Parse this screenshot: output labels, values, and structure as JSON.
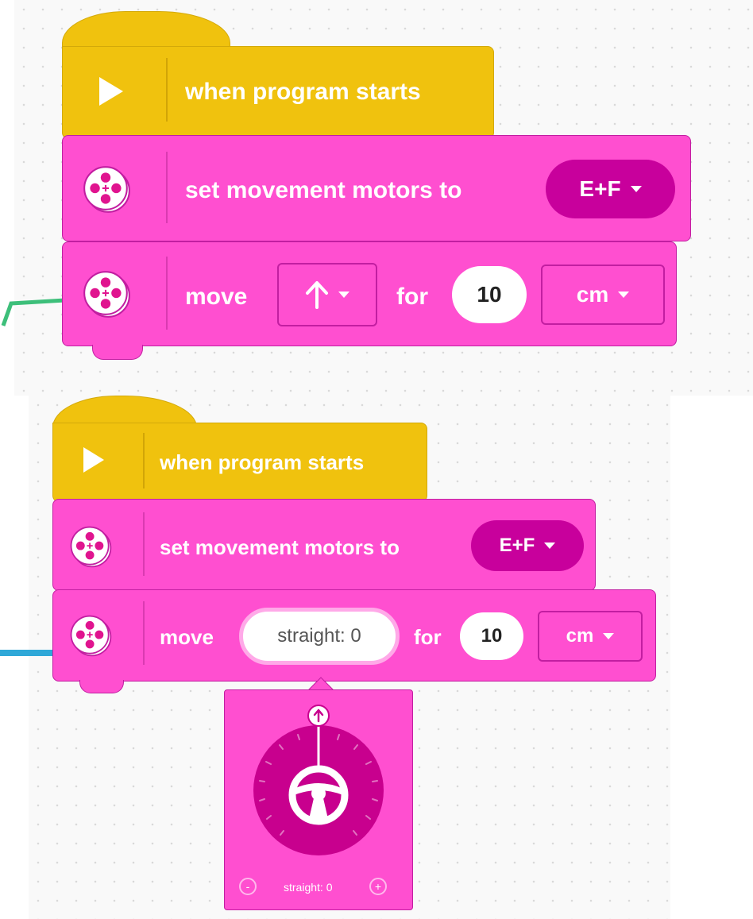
{
  "colors": {
    "hat": "#f0c20e",
    "motion": "#ff4fd0",
    "motion_dark": "#c8009c",
    "connector_green": "#3dbf7a",
    "connector_blue": "#2fa8d8"
  },
  "program_top": {
    "hat_label": "when program starts",
    "set_label": "set movement motors to",
    "set_value": "E+F",
    "move_label": "move",
    "direction_icon": "up-arrow-icon",
    "for_label": "for",
    "amount": "10",
    "unit": "cm"
  },
  "program_bottom": {
    "hat_label": "when program starts",
    "set_label": "set movement motors to",
    "set_value": "E+F",
    "move_label": "move",
    "steer_value": "straight: 0",
    "for_label": "for",
    "amount": "10",
    "unit": "cm"
  },
  "steering_popup": {
    "readout": "straight: 0",
    "minus_label": "-",
    "plus_label": "+"
  }
}
